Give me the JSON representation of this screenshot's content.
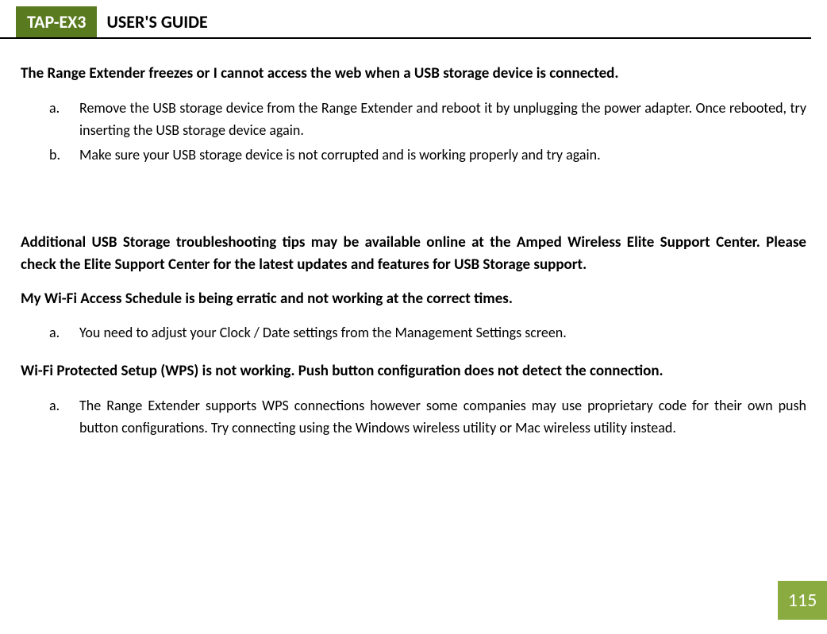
{
  "header": {
    "badge": "TAP-EX3",
    "title": "USER'S GUIDE"
  },
  "sections": {
    "s1": {
      "heading": "The Range Extender freezes or I cannot access the web when a USB storage device is connected.",
      "items": {
        "a": {
          "marker": "a.",
          "text": "Remove the USB storage device from the Range Extender and reboot it by unplugging the power adapter. Once rebooted, try inserting the USB storage device again."
        },
        "b": {
          "marker": "b.",
          "text": "Make sure your USB storage device is not corrupted and is working properly and try again."
        }
      }
    },
    "s2": {
      "heading": "Additional USB Storage troubleshooting tips may be available online at the Amped Wireless Elite Support Center. Please check the Elite Support Center for the latest updates and features for USB Storage support."
    },
    "s3": {
      "heading": "My Wi-Fi Access Schedule is being erratic and not working at the correct times.",
      "items": {
        "a": {
          "marker": "a.",
          "text": "You need to adjust your Clock / Date settings from the Management Settings screen."
        }
      }
    },
    "s4": {
      "heading": "Wi-Fi Protected Setup (WPS) is not working. Push button configuration does not detect the connection.",
      "items": {
        "a": {
          "marker": "a.",
          "text": "The Range Extender supports WPS connections however some companies may use proprietary code for their own push button configurations. Try connecting using the Windows wireless utility or Mac wireless utility instead."
        }
      }
    }
  },
  "pageNumber": "115"
}
